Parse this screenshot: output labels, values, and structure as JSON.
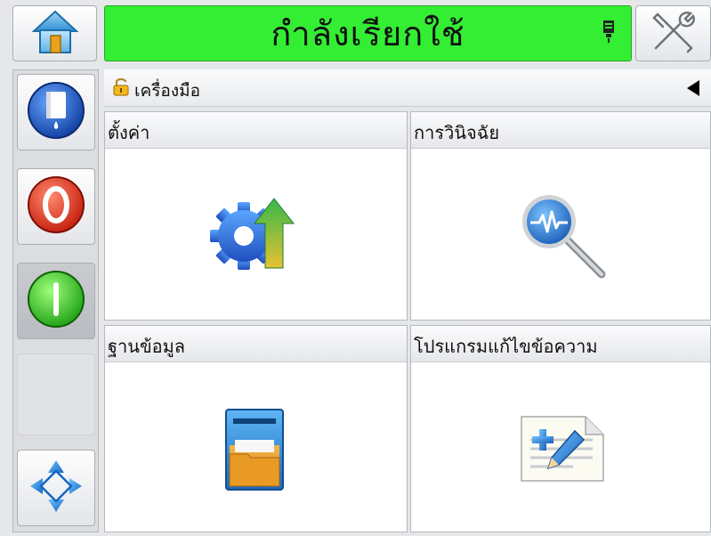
{
  "status": {
    "text": "กำลังเรียกใช้",
    "color": "#33ee33"
  },
  "header": {
    "home_icon": "home-icon",
    "tools_icon": "tools-icon"
  },
  "sidebar": {
    "items": [
      {
        "icon": "ink-cartridge-icon"
      },
      {
        "icon": "stop-icon"
      },
      {
        "icon": "start-icon"
      },
      {
        "icon": "navigation-arrows-icon"
      }
    ]
  },
  "breadcrumb": {
    "label": "เครื่องมือ"
  },
  "tiles": [
    {
      "title": "ตั้งค่า",
      "icon": "settings-gear-icon"
    },
    {
      "title": "การวินิจฉัย",
      "icon": "diagnostics-magnifier-icon"
    },
    {
      "title": "ฐานข้อมูล",
      "icon": "database-cabinet-icon"
    },
    {
      "title": "โปรแกรมแก้ไขข้อความ",
      "icon": "message-editor-icon"
    }
  ]
}
